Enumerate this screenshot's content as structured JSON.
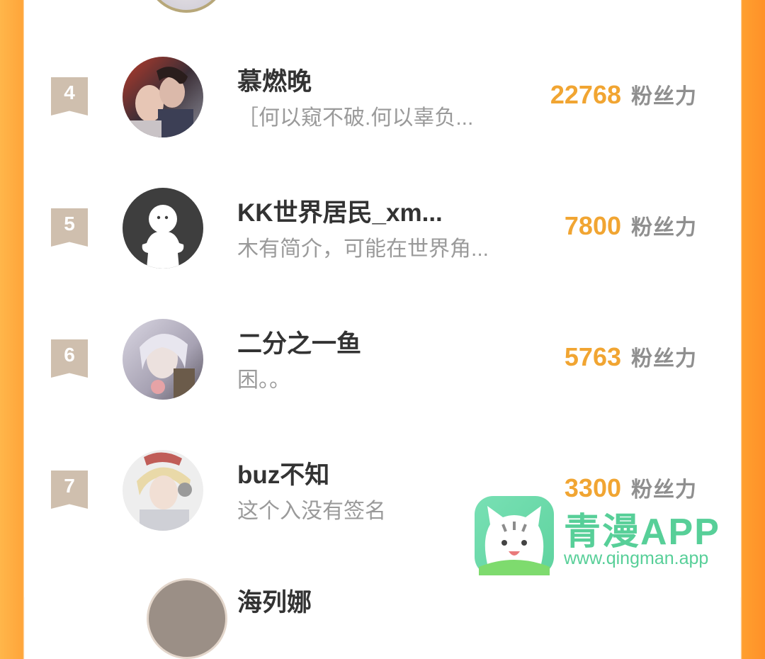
{
  "colors": {
    "accent_orange": "#f1a532",
    "rank_badge": "#cfbfae",
    "watermark_green": "#57cf98"
  },
  "ranking": [
    {
      "rank": "4",
      "name": "慕燃晚",
      "desc": "［何以窥不破.何以辜负...",
      "fans": "22768",
      "unit": "粉丝力"
    },
    {
      "rank": "5",
      "name": "KK世界居民_xm...",
      "desc": "木有简介，可能在世界角...",
      "fans": "7800",
      "unit": "粉丝力"
    },
    {
      "rank": "6",
      "name": "二分之一鱼",
      "desc": "困。。",
      "fans": "5763",
      "unit": "粉丝力"
    },
    {
      "rank": "7",
      "name": "buz不知",
      "desc": "这个入没有签名",
      "fans": "3300",
      "unit": "粉丝力"
    }
  ],
  "partial_next": {
    "name": "海列娜"
  },
  "watermark": {
    "title": "青漫APP",
    "url": "www.qingman.app"
  }
}
